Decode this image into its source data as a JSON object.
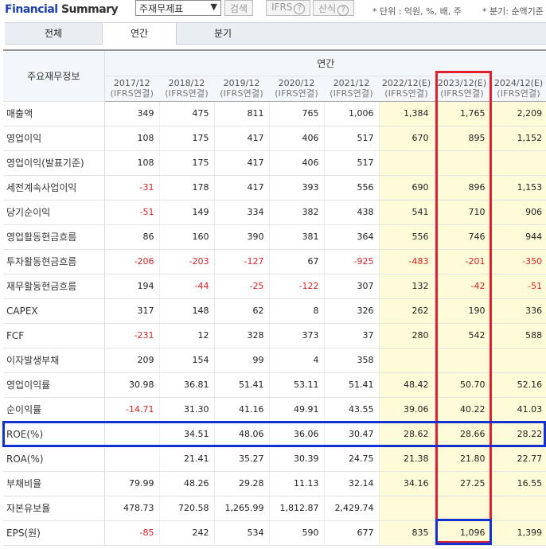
{
  "header": {
    "title_part1": "Financial",
    "title_part2": "Summary",
    "statement_select": "주재무제표",
    "search_button": "검색",
    "ifrs_button": "IFRS",
    "formula_button": "산식",
    "help_glyph": "?",
    "unit_note": "* 단위 : 억원, %, 배, 주",
    "quarter_note": "* 분기: 순액기준"
  },
  "tabs": [
    {
      "label": "전체",
      "active": false
    },
    {
      "label": "연간",
      "active": true
    },
    {
      "label": "분기",
      "active": false
    }
  ],
  "table": {
    "row_header": "주요재무정보",
    "group_header": "연간",
    "columns": [
      {
        "period": "2017/12",
        "basis": "(IFRS연결)",
        "estimate": false
      },
      {
        "period": "2018/12",
        "basis": "(IFRS연결)",
        "estimate": false
      },
      {
        "period": "2019/12",
        "basis": "(IFRS연결)",
        "estimate": false
      },
      {
        "period": "2020/12",
        "basis": "(IFRS연결)",
        "estimate": false
      },
      {
        "period": "2021/12",
        "basis": "(IFRS연결)",
        "estimate": false
      },
      {
        "period": "2022/12(E)",
        "basis": "(IFRS연결)",
        "estimate": true
      },
      {
        "period": "2023/12(E)",
        "basis": "(IFRS연결)",
        "estimate": true
      },
      {
        "period": "2024/12(E)",
        "basis": "(IFRS연결)",
        "estimate": true
      }
    ],
    "rows": [
      {
        "label": "매출액",
        "values": [
          "349",
          "475",
          "811",
          "765",
          "1,006",
          "1,384",
          "1,765",
          "2,209"
        ]
      },
      {
        "label": "영업이익",
        "values": [
          "108",
          "175",
          "417",
          "406",
          "517",
          "670",
          "895",
          "1,152"
        ]
      },
      {
        "label": "영업이익(발표기준)",
        "values": [
          "108",
          "175",
          "417",
          "406",
          "517",
          "",
          "",
          ""
        ]
      },
      {
        "label": "세전계속사업이익",
        "values": [
          "-31",
          "178",
          "417",
          "393",
          "556",
          "690",
          "896",
          "1,153"
        ]
      },
      {
        "label": "당기순이익",
        "values": [
          "-51",
          "149",
          "334",
          "382",
          "438",
          "541",
          "710",
          "906"
        ]
      },
      {
        "label": "영업활동현금흐름",
        "values": [
          "86",
          "160",
          "390",
          "381",
          "364",
          "556",
          "746",
          "944"
        ]
      },
      {
        "label": "투자활동현금흐름",
        "values": [
          "-206",
          "-203",
          "-127",
          "67",
          "-925",
          "-483",
          "-201",
          "-350"
        ]
      },
      {
        "label": "재무활동현금흐름",
        "values": [
          "194",
          "-44",
          "-25",
          "-122",
          "307",
          "132",
          "-42",
          "-51"
        ]
      },
      {
        "label": "CAPEX",
        "values": [
          "317",
          "148",
          "62",
          "8",
          "326",
          "262",
          "190",
          "336"
        ]
      },
      {
        "label": "FCF",
        "values": [
          "-231",
          "12",
          "328",
          "373",
          "37",
          "280",
          "542",
          "588"
        ]
      },
      {
        "label": "이자발생부채",
        "values": [
          "209",
          "154",
          "99",
          "4",
          "358",
          "",
          "",
          ""
        ]
      },
      {
        "label": "영업이익률",
        "values": [
          "30.98",
          "36.81",
          "51.41",
          "53.11",
          "51.41",
          "48.42",
          "50.70",
          "52.16"
        ]
      },
      {
        "label": "순이익률",
        "values": [
          "-14.71",
          "31.30",
          "41.16",
          "49.91",
          "43.55",
          "39.06",
          "40.22",
          "41.03"
        ]
      },
      {
        "label": "ROE(%)",
        "values": [
          "",
          "34.51",
          "48.06",
          "36.06",
          "30.47",
          "28.62",
          "28.66",
          "28.22"
        ]
      },
      {
        "label": "ROA(%)",
        "values": [
          "",
          "21.41",
          "35.27",
          "30.39",
          "24.75",
          "21.38",
          "21.80",
          "22.77"
        ]
      },
      {
        "label": "부채비율",
        "values": [
          "79.99",
          "48.26",
          "29.28",
          "11.13",
          "32.14",
          "34.16",
          "27.25",
          "16.55"
        ]
      },
      {
        "label": "자본유보율",
        "values": [
          "478.73",
          "720.58",
          "1,265.99",
          "1,812.87",
          "2,429.74",
          "",
          "",
          ""
        ]
      },
      {
        "label": "EPS(원)",
        "values": [
          "-85",
          "242",
          "534",
          "590",
          "677",
          "835",
          "1,096",
          "1,399"
        ]
      }
    ]
  },
  "highlights": {
    "red_column": "2023/12(E)",
    "blue_row": "ROE(%)",
    "blue_cell": {
      "row": "EPS(원)",
      "column": "2023/12(E)"
    },
    "red_color": "#e0202a",
    "blue_color": "#1530d0",
    "estimate_bg": "#fdfbd8",
    "negative_color": "#e02020",
    "title_color": "#1e40af"
  }
}
